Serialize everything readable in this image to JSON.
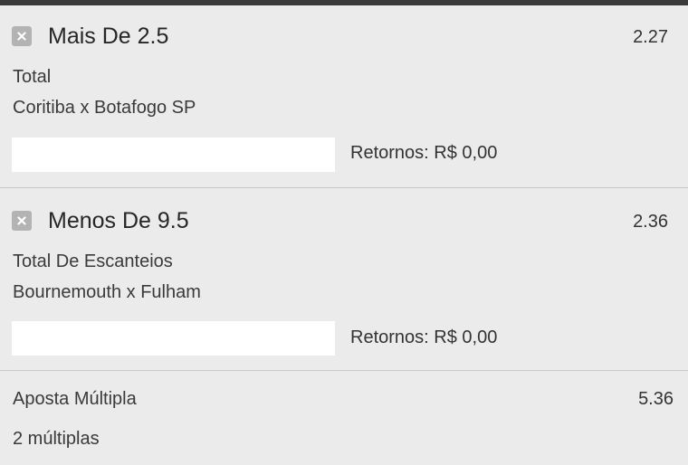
{
  "bets": [
    {
      "selection": "Mais De 2.5",
      "odds": "2.27",
      "market": "Total",
      "event": "Coritiba x Botafogo SP",
      "stake_value": "",
      "returns": "Retornos: R$ 0,00"
    },
    {
      "selection": "Menos De 9.5",
      "odds": "2.36",
      "market": "Total De Escanteios",
      "event": "Bournemouth x Fulham",
      "stake_value": "",
      "returns": "Retornos: R$ 0,00"
    }
  ],
  "multiple": {
    "label": "Aposta Múltipla",
    "odds": "5.36",
    "count": "2 múltiplas"
  },
  "colors": {
    "background": "#ebebeb",
    "top_bar": "#3a3a3a",
    "remove_icon_bg": "#b3b3b3",
    "divider": "#c8c8c8"
  },
  "icons": {
    "remove": "close-icon"
  }
}
